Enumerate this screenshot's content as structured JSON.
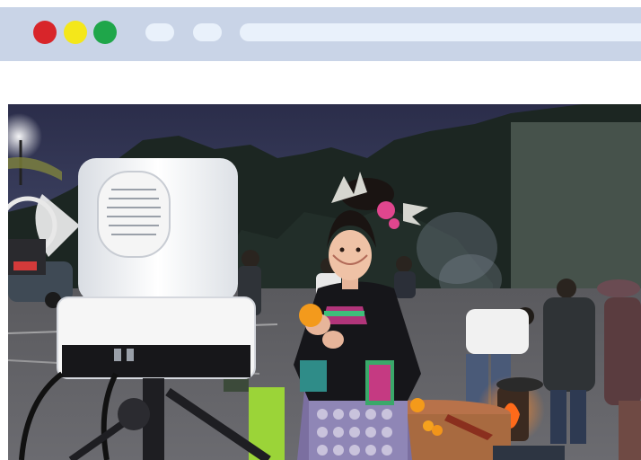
{
  "browser": {
    "controls": [
      {
        "name": "close",
        "color": "#d8252a"
      },
      {
        "name": "minimize",
        "color": "#f4e71a"
      },
      {
        "name": "maximize",
        "color": "#1fa64a"
      }
    ],
    "bar_color": "#c9d4e7",
    "field_color": "#e9f1fb"
  },
  "photo": {
    "scene": "night-outdoor-livestream",
    "icons": [
      "streaming-camera-icon",
      "street-lamp-icon"
    ]
  }
}
